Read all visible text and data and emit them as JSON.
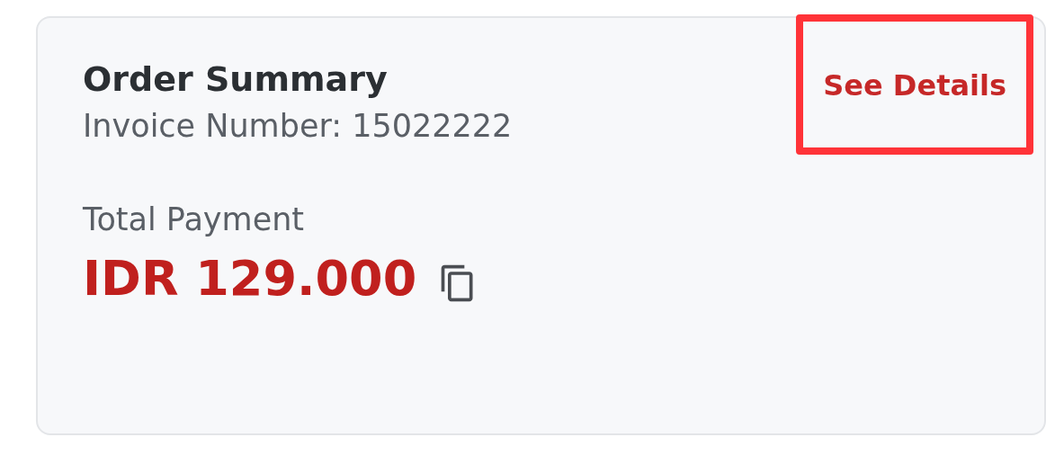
{
  "card": {
    "title": "Order Summary",
    "invoice": "Invoice Number: 15022222",
    "see_details": {
      "label": "See Details",
      "highlighted": true
    },
    "total_label": "Total Payment",
    "amount": "IDR 129.000"
  }
}
